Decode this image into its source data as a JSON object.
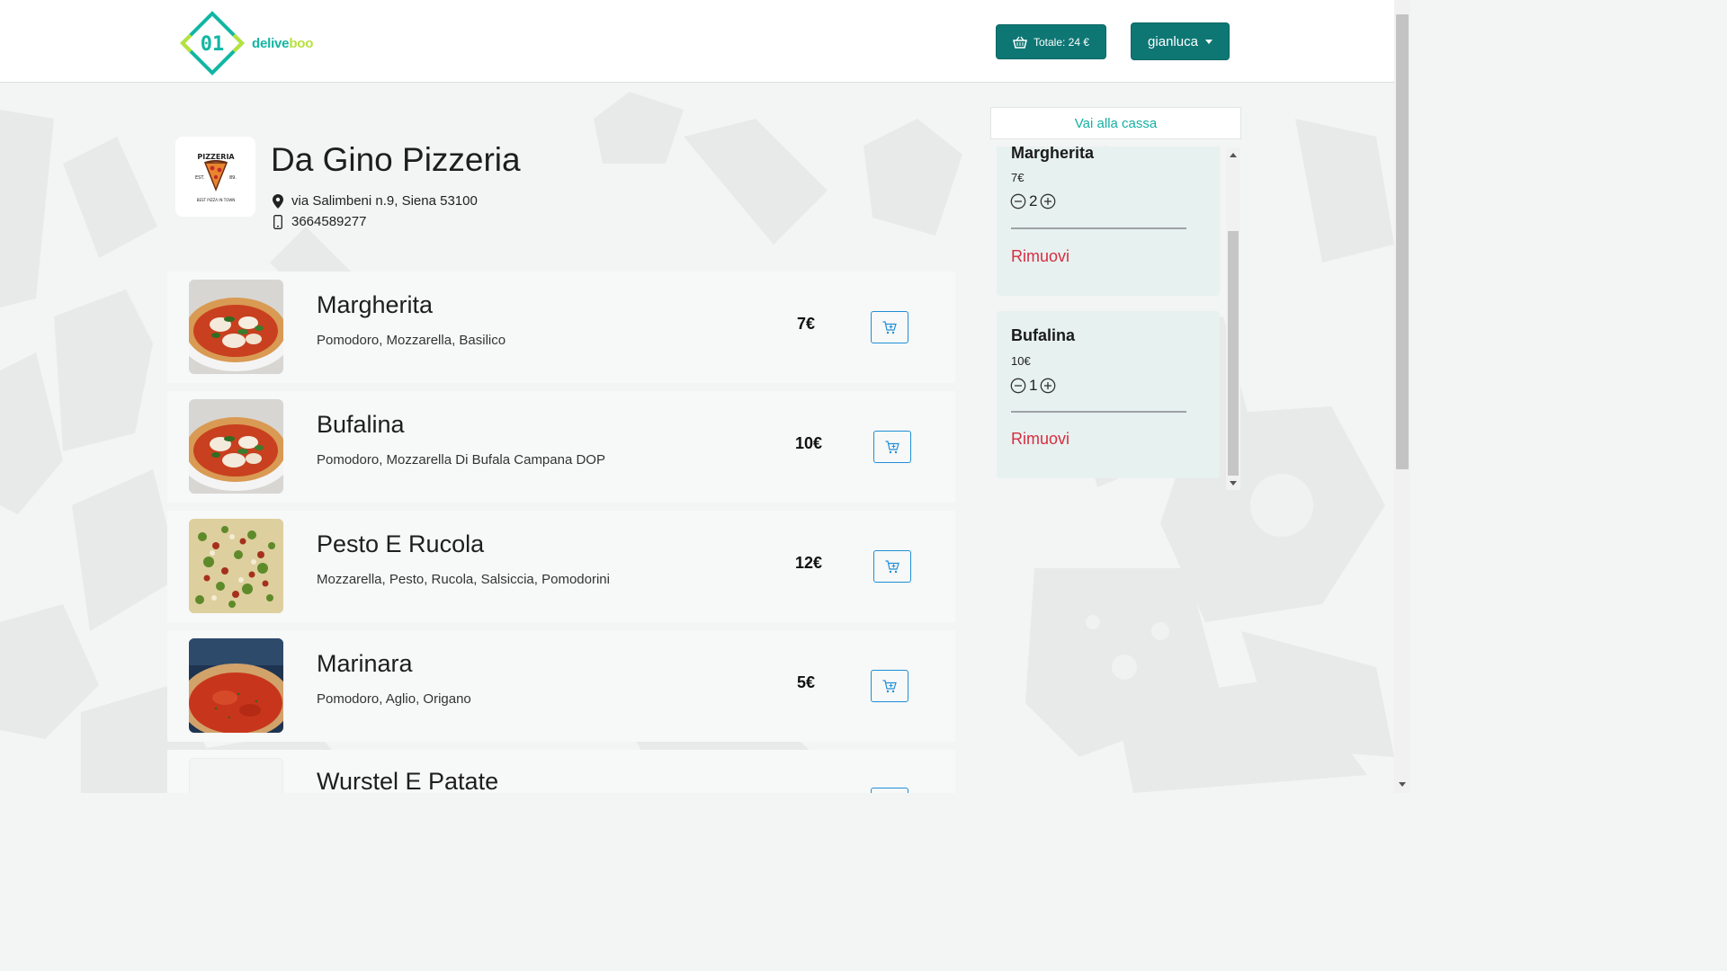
{
  "header": {
    "logo_mark": "01",
    "logo_text_a": "delive",
    "logo_text_b": "boo",
    "cart_button": "Totale: 24 €",
    "user_menu": "gianluca"
  },
  "restaurant": {
    "logo_lines": [
      "PIZZERIA",
      "EST.",
      "89.",
      "BEST PIZZA IN TOWN"
    ],
    "name": "Da Gino Pizzeria",
    "address": "via Salimbeni n.9, Siena 53100",
    "phone": "3664589277"
  },
  "menu": {
    "items": [
      {
        "name": "Margherita",
        "description": "Pomodoro, Mozzarella, Basilico",
        "price": "7€",
        "image": "margherita"
      },
      {
        "name": "Bufalina",
        "description": "Pomodoro, Mozzarella Di Bufala Campana DOP",
        "price": "10€",
        "image": "margherita"
      },
      {
        "name": "Pesto E Rucola",
        "description": "Mozzarella, Pesto, Rucola, Salsiccia, Pomodorini",
        "price": "12€",
        "image": "pesto"
      },
      {
        "name": "Marinara",
        "description": "Pomodoro, Aglio, Origano",
        "price": "5€",
        "image": "marinara"
      },
      {
        "name": "Wurstel E Patate",
        "description": "",
        "price": "",
        "image": "blank"
      }
    ]
  },
  "cart": {
    "checkout_label": "Vai alla cassa",
    "items": [
      {
        "name": "Margherita",
        "price": "7€",
        "qty": "2",
        "remove": "Rimuovi"
      },
      {
        "name": "Bufalina",
        "price": "10€",
        "qty": "1",
        "remove": "Rimuovi"
      }
    ]
  },
  "colors": {
    "primary": "#0e7774",
    "accent": "#15b0a2",
    "logo_green": "#b6e23b",
    "remove_red": "#d62e41",
    "cart_item_bg": "#e7f1f0",
    "add_button_border": "#1f8fd6"
  },
  "icons": {
    "cart_button": "basket-icon",
    "address": "map-pin-icon",
    "phone": "mobile-phone-icon",
    "add_to_cart": "cart-plus-icon",
    "qty_minus": "dash-circle-icon",
    "qty_plus": "plus-circle-icon"
  }
}
